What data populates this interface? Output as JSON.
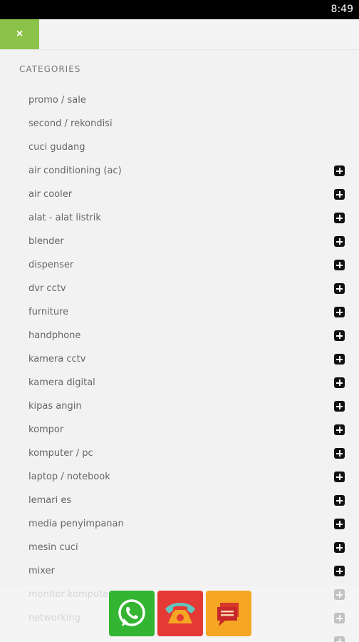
{
  "status": {
    "time": "8:49"
  },
  "header": {
    "close_label": "×"
  },
  "categories": {
    "title": "CATEGORIES",
    "items": [
      {
        "label": "promo / sale",
        "expandable": false
      },
      {
        "label": "second / rekondisi",
        "expandable": false
      },
      {
        "label": "cuci gudang",
        "expandable": false
      },
      {
        "label": "air conditioning (ac)",
        "expandable": true
      },
      {
        "label": "air cooler",
        "expandable": true
      },
      {
        "label": "alat - alat listrik",
        "expandable": true
      },
      {
        "label": "blender",
        "expandable": true
      },
      {
        "label": "dispenser",
        "expandable": true
      },
      {
        "label": "dvr cctv",
        "expandable": true
      },
      {
        "label": "furniture",
        "expandable": true
      },
      {
        "label": "handphone",
        "expandable": true
      },
      {
        "label": "kamera cctv",
        "expandable": true
      },
      {
        "label": "kamera digital",
        "expandable": true
      },
      {
        "label": "kipas angin",
        "expandable": true
      },
      {
        "label": "kompor",
        "expandable": true
      },
      {
        "label": "komputer / pc",
        "expandable": true
      },
      {
        "label": "laptop / notebook",
        "expandable": true
      },
      {
        "label": "lemari es",
        "expandable": true
      },
      {
        "label": "media penyimpanan",
        "expandable": true
      },
      {
        "label": "mesin cuci",
        "expandable": true
      },
      {
        "label": "mixer",
        "expandable": true
      },
      {
        "label": "monitor komputer",
        "expandable": true
      },
      {
        "label": "networking",
        "expandable": true
      },
      {
        "label": "",
        "expandable": true
      }
    ]
  },
  "actions": {
    "whatsapp_icon": "whatsapp-icon",
    "call_icon": "phone-icon",
    "sms_icon": "message-icon",
    "colors": {
      "whatsapp": "#33b531",
      "call": "#e53935",
      "sms": "#f5a623",
      "accent": "#8bc34a"
    }
  }
}
